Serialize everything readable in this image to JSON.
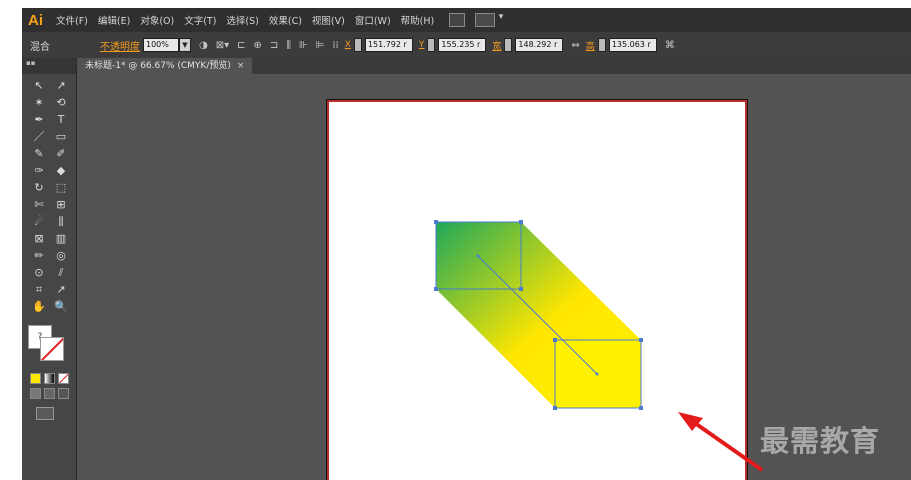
{
  "menubar": {
    "logo": "Ai",
    "items": [
      "文件(F)",
      "编辑(E)",
      "对象(O)",
      "文字(T)",
      "选择(S)",
      "效果(C)",
      "视图(V)",
      "窗口(W)",
      "帮助(H)"
    ]
  },
  "control": {
    "mode": "混合",
    "opacity_label": "不透明度",
    "opacity_value": "100%",
    "x_label": "X",
    "x_value": "151.792 r",
    "y_label": "Y",
    "y_value": "155.235 r",
    "w_label": "宽",
    "w_value": "148.292 r",
    "h_label": "高",
    "h_value": "135.063 r"
  },
  "tab": {
    "title": "未标题-1* @ 66.67% (CMYK/预览)",
    "close": "×"
  },
  "tools": [
    "↖",
    "↗",
    "✶",
    "⟲",
    "✒",
    "T",
    "／",
    "▭",
    "✎",
    "✐",
    "✑",
    "◆",
    "↻",
    "⬚",
    "✄",
    "⊞",
    "☄",
    "⫼",
    "⊠",
    "▥",
    "✏",
    "◎",
    "⊙",
    "⫽",
    "⌗",
    "↗",
    "✋",
    "🔍"
  ],
  "fill_glyph": "?",
  "watermark": "最需教育",
  "colors": {
    "gradient_start": "#1fa85a",
    "gradient_end": "#fff200",
    "selection": "#4a7bd0",
    "artboard_border": "#b72f2f",
    "arrow": "#e31b1b"
  }
}
